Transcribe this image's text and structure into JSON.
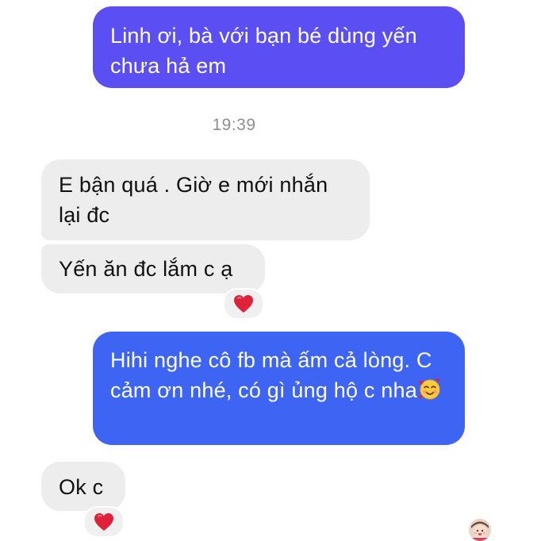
{
  "conversation": {
    "messages": [
      {
        "direction": "outgoing",
        "text": "Linh ơi, bà với bạn bé dùng yến chưa hả em"
      },
      {
        "direction": "incoming",
        "text": "E bận quá . Giờ e mới nhắn lại đc"
      },
      {
        "direction": "incoming",
        "text": "Yến ăn đc lắm c ạ",
        "reaction": "heart-icon"
      },
      {
        "direction": "outgoing",
        "text": "Hihi nghe cô fb mà ấm cả lòng. C cảm ơn nhé, có gì ủng hộ c nha",
        "trailing_emoji": "smiling-face-with-hearts-icon"
      },
      {
        "direction": "incoming",
        "text": "Ok c",
        "reaction": "heart-icon"
      }
    ],
    "timestamp": "19:39",
    "read_receipt": "avatar",
    "colors": {
      "outgoing_top": "#5b4ef2",
      "outgoing_bottom": "#3d64f2",
      "incoming": "#ededed",
      "heart": "#e0213a"
    }
  }
}
